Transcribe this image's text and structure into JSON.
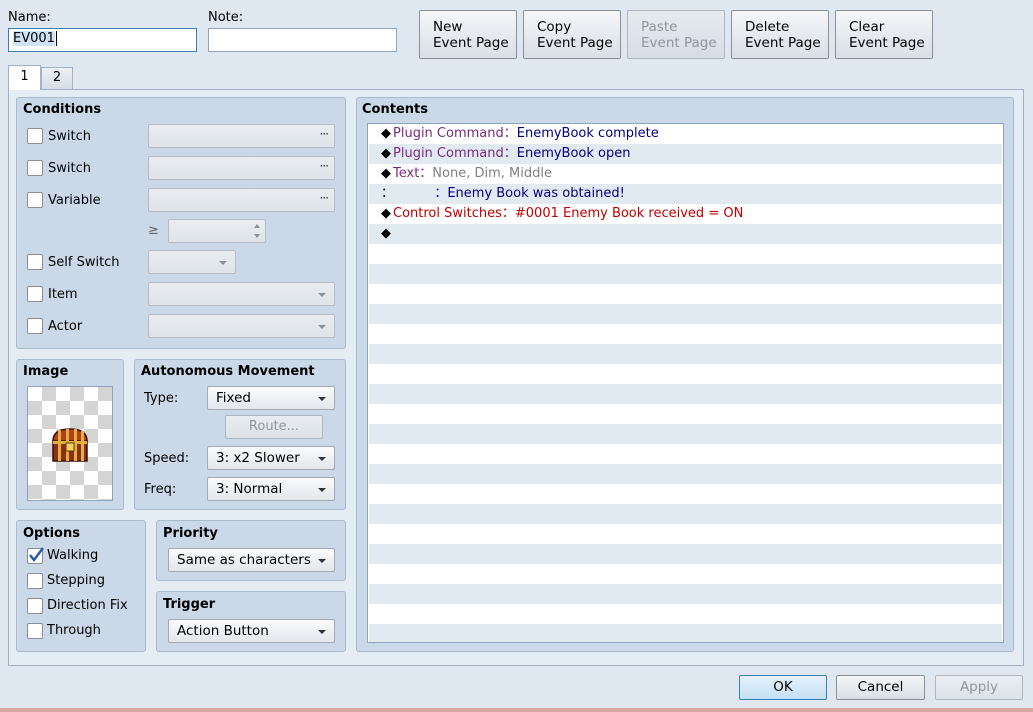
{
  "header": {
    "name_label": "Name:",
    "name_value": "EV001",
    "note_label": "Note:",
    "note_value": "",
    "buttons": [
      {
        "line1": "New",
        "line2": "Event Page"
      },
      {
        "line1": "Copy",
        "line2": "Event Page"
      },
      {
        "line1": "Paste",
        "line2": "Event Page"
      },
      {
        "line1": "Delete",
        "line2": "Event Page"
      },
      {
        "line1": "Clear",
        "line2": "Event Page"
      }
    ]
  },
  "tabs": [
    "1",
    "2"
  ],
  "conditions": {
    "title": "Conditions",
    "switch1": "Switch",
    "switch2": "Switch",
    "variable": "Variable",
    "gte": "≥",
    "self_switch": "Self Switch",
    "item": "Item",
    "actor": "Actor",
    "dots": "···"
  },
  "image": {
    "title": "Image"
  },
  "movement": {
    "title": "Autonomous Movement",
    "type_label": "Type:",
    "type_value": "Fixed",
    "route_label": "Route...",
    "speed_label": "Speed:",
    "speed_value": "3: x2 Slower",
    "freq_label": "Freq:",
    "freq_value": "3: Normal"
  },
  "options": {
    "title": "Options",
    "items": [
      {
        "label": "Walking",
        "checked": true
      },
      {
        "label": "Stepping",
        "checked": false
      },
      {
        "label": "Direction Fix",
        "checked": false
      },
      {
        "label": "Through",
        "checked": false
      }
    ]
  },
  "priority": {
    "title": "Priority",
    "value": "Same as characters"
  },
  "trigger": {
    "title": "Trigger",
    "value": "Action Button"
  },
  "contents": {
    "title": "Contents",
    "lines": [
      {
        "bullet": "◆",
        "a": "Plugin Command：",
        "b": "EnemyBook complete",
        "color_a": "#7a2a7f",
        "color_b": "#000080"
      },
      {
        "bullet": "◆",
        "a": "Plugin Command：",
        "b": "EnemyBook open",
        "color_a": "#7a2a7f",
        "color_b": "#000080"
      },
      {
        "bullet": "◆",
        "a": "Text：",
        "b": "None, Dim, Middle",
        "color_a": "#7a2a7f",
        "color_b": "#808080"
      },
      {
        "bullet": "：",
        "a": "          ：",
        "b": "Enemy Book was obtained!",
        "color_a": "#000080",
        "color_b": "#000080"
      },
      {
        "bullet": "◆",
        "a": "Control Switches：",
        "b": "#0001 Enemy Book received = ON",
        "color_a": "#c00000",
        "color_b": "#c00000"
      },
      {
        "bullet": "◆",
        "a": "",
        "b": "",
        "color_a": "#000",
        "color_b": "#000"
      }
    ]
  },
  "footer": {
    "ok": "OK",
    "cancel": "Cancel",
    "apply": "Apply"
  }
}
